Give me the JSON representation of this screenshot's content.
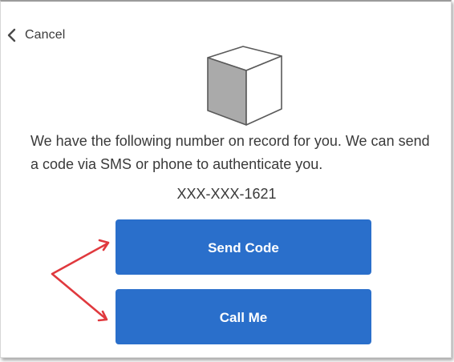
{
  "nav": {
    "cancel_label": "Cancel"
  },
  "logo": {
    "icon": "cube-icon"
  },
  "content": {
    "message": "We have the following number on record for you. We can send a code via SMS or phone to authenticate you.",
    "phone_number": "XXX-XXX-1621"
  },
  "actions": {
    "send_code_label": "Send Code",
    "call_me_label": "Call Me"
  },
  "annotation": {
    "arrow_color": "#e0393e"
  },
  "colors": {
    "primary": "#2a6fcb",
    "text": "#3a3a3a"
  }
}
